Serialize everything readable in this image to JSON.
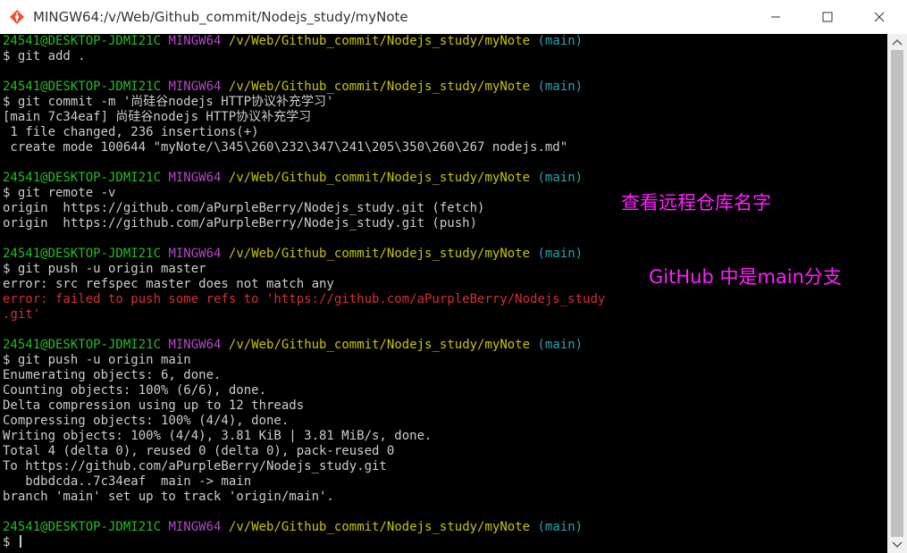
{
  "window": {
    "title": "MINGW64:/v/Web/Github_commit/Nodejs_study/myNote",
    "icons": {
      "app": "git-bash-icon",
      "minimize": "minimize-icon",
      "maximize": "maximize-icon",
      "close": "close-icon"
    }
  },
  "prompt": {
    "user": "24541@DESKTOP-JDMI21C",
    "host": "MINGW64",
    "path": "/v/Web/Github_commit/Nodejs_study/myNote",
    "branch": "(main)",
    "symbol": "$"
  },
  "terminal": {
    "cmd1": "$ git add .",
    "cmd2": "$ git commit -m '尚硅谷nodejs HTTP协议补充学习'",
    "out2_1": "[main 7c34eaf] 尚硅谷nodejs HTTP协议补充学习",
    "out2_2": " 1 file changed, 236 insertions(+)",
    "out2_3": " create mode 100644 \"myNote/\\345\\260\\232\\347\\241\\205\\350\\260\\267 nodejs.md\"",
    "cmd3": "$ git remote -v",
    "out3_1": "origin  https://github.com/aPurpleBerry/Nodejs_study.git (fetch)",
    "out3_2": "origin  https://github.com/aPurpleBerry/Nodejs_study.git (push)",
    "cmd4": "$ git push -u origin master",
    "out4_1": "error: src refspec master does not match any",
    "out4_2": "error: failed to push some refs to 'https://github.com/aPurpleBerry/Nodejs_study",
    "out4_3": ".git'",
    "cmd5": "$ git push -u origin main",
    "out5_1": "Enumerating objects: 6, done.",
    "out5_2": "Counting objects: 100% (6/6), done.",
    "out5_3": "Delta compression using up to 12 threads",
    "out5_4": "Compressing objects: 100% (4/4), done.",
    "out5_5": "Writing objects: 100% (4/4), 3.81 KiB | 3.81 MiB/s, done.",
    "out5_6": "Total 4 (delta 0), reused 0 (delta 0), pack-reused 0",
    "out5_7": "To https://github.com/aPurpleBerry/Nodejs_study.git",
    "out5_8": "   bdbdcda..7c34eaf  main -> main",
    "out5_9": "branch 'main' set up to track 'origin/main'.",
    "cmd6": "$ "
  },
  "annotations": {
    "remote": "查看远程仓库名字",
    "branch": "GitHub 中是main分支"
  },
  "colors": {
    "user": "#25bc24",
    "host": "#b148c6",
    "path": "#c7c400",
    "branch": "#2aa1b3",
    "output": "#cccccc",
    "error": "#d32f2f",
    "annotation": "#ff20ff"
  }
}
